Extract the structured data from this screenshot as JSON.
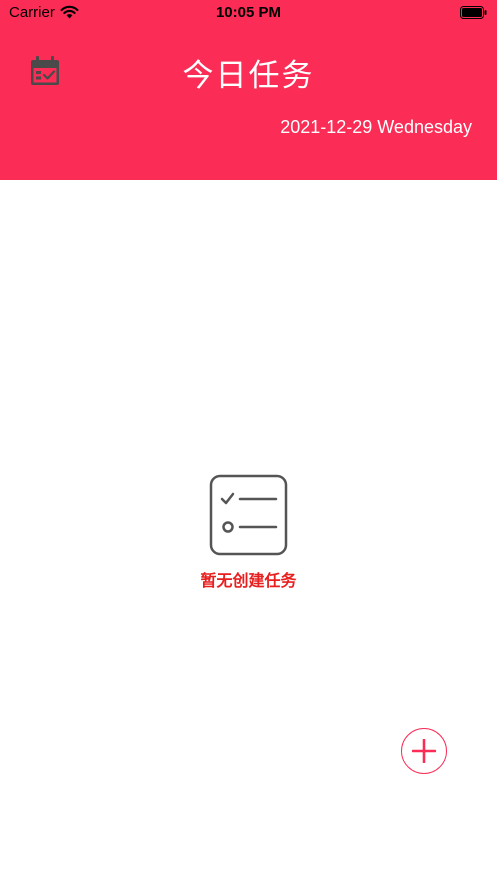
{
  "status_bar": {
    "carrier": "Carrier",
    "time": "10:05 PM",
    "wifi_icon": "wifi-icon",
    "battery_icon": "battery-icon"
  },
  "header": {
    "title": "今日任务",
    "date": "2021-12-29 Wednesday",
    "calendar_icon": "calendar-check-icon",
    "background_color": "#fb2c55"
  },
  "empty_state": {
    "icon": "checklist-icon",
    "message": "暂无创建任务",
    "message_color": "#e81f1f"
  },
  "fab": {
    "icon": "plus-icon",
    "accent_color": "#fb2c55"
  }
}
